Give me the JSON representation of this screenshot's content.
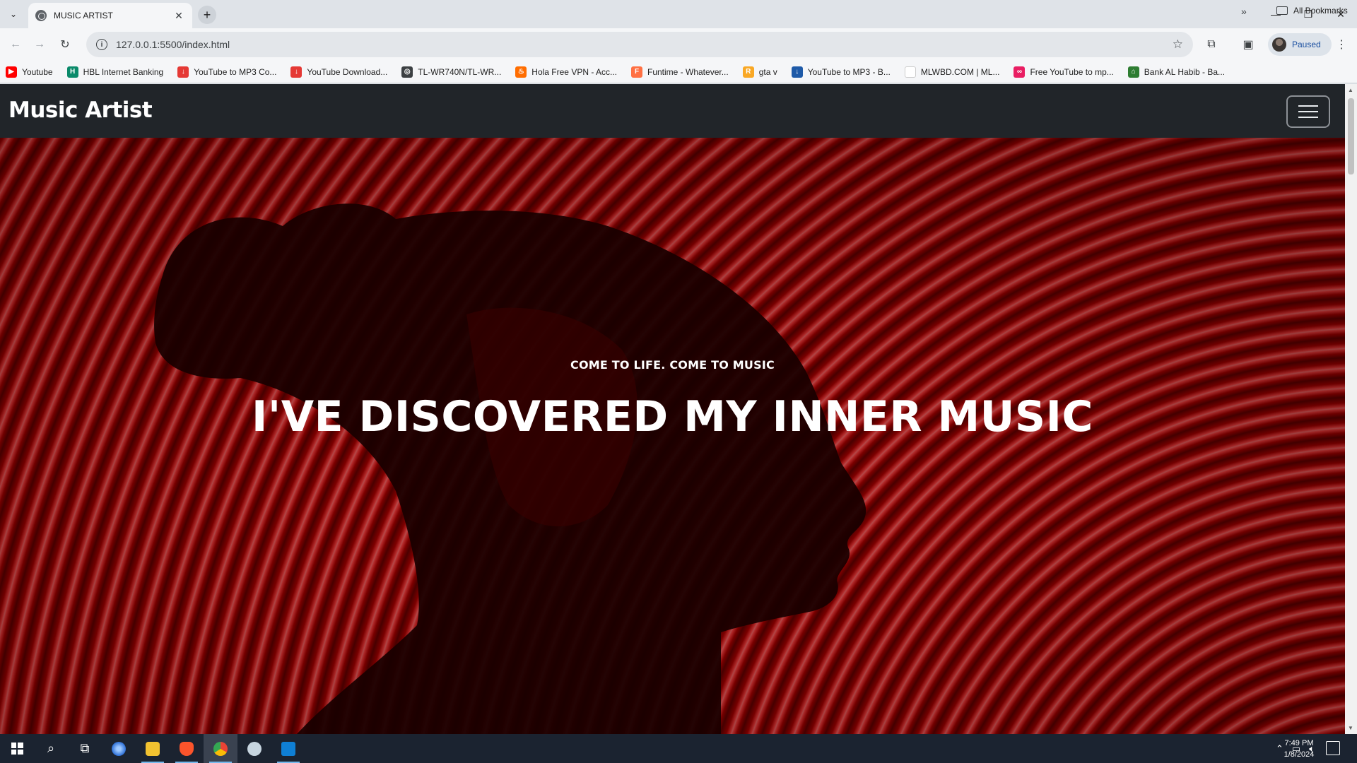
{
  "browser": {
    "tab": {
      "title": "MUSIC ARTIST",
      "close": "✕"
    },
    "new_tab": "+",
    "window_controls": {
      "minimize": "—",
      "restore": "❐",
      "close": "✕"
    },
    "url": "127.0.0.1:5500/index.html",
    "profile_status": "Paused",
    "bookmarks": [
      {
        "label": "Youtube",
        "icon": "youtube-icon",
        "color": "#ff0000",
        "glyph": "▶"
      },
      {
        "label": "HBL Internet Banking",
        "icon": "hbl-icon",
        "color": "#0a8a6a",
        "glyph": "H"
      },
      {
        "label": "YouTube to MP3 Co...",
        "icon": "download-icon",
        "color": "#e53935",
        "glyph": "↓"
      },
      {
        "label": "YouTube Download...",
        "icon": "download-icon",
        "color": "#e53935",
        "glyph": "↓"
      },
      {
        "label": "TL-WR740N/TL-WR...",
        "icon": "globe-icon",
        "color": "#3c4043",
        "glyph": "◎"
      },
      {
        "label": "Hola Free VPN - Acc...",
        "icon": "flame-icon",
        "color": "#ff6d00",
        "glyph": "♨"
      },
      {
        "label": "Funtime - Whatever...",
        "icon": "funtime-icon",
        "color": "#ff7043",
        "glyph": "F"
      },
      {
        "label": "gta v",
        "icon": "gta-icon",
        "color": "#f9a825",
        "glyph": "R"
      },
      {
        "label": "YouTube to MP3 - B...",
        "icon": "download-icon",
        "color": "#1e5aa8",
        "glyph": "↓"
      },
      {
        "label": "MLWBD.COM | ML...",
        "icon": "page-icon",
        "color": "#ffffff",
        "glyph": ""
      },
      {
        "label": "Free YouTube to mp...",
        "icon": "link-icon",
        "color": "#e91e63",
        "glyph": "∞"
      },
      {
        "label": "Bank AL Habib - Ba...",
        "icon": "bank-icon",
        "color": "#2e7d32",
        "glyph": "⌂"
      }
    ],
    "bookmarks_more": "»",
    "all_bookmarks": "All Bookmarks"
  },
  "site": {
    "brand": "Music Artist",
    "hero": {
      "subtitle": "COME TO LIFE. COME TO MUSIC",
      "title": "I'VE DISCOVERED MY INNER MUSIC"
    },
    "colors": {
      "navbar": "#212529",
      "hero_red": "#d50000"
    }
  },
  "taskbar": {
    "apps": [
      "start-icon",
      "search-icon",
      "task-view-icon",
      "cortana-icon",
      "file-explorer-icon",
      "brave-icon",
      "chrome-icon",
      "steam-icon",
      "vscode-icon"
    ],
    "clock_time": "7:49 PM",
    "clock_date": "1/8/2024"
  }
}
